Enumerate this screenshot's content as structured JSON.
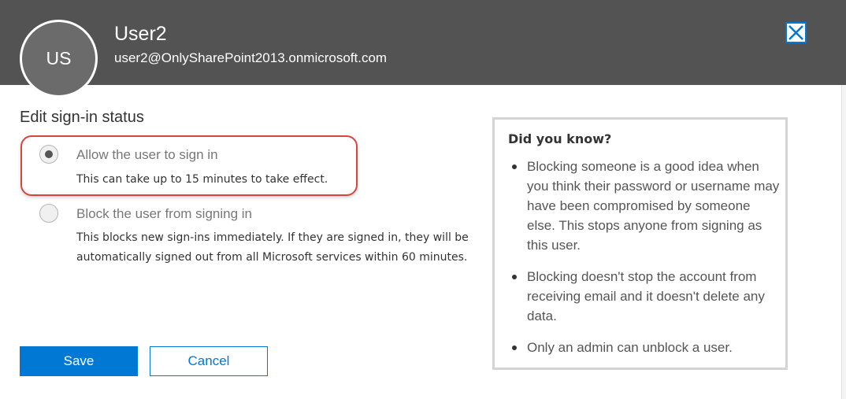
{
  "user": {
    "initials": "US",
    "name": "User2",
    "email": "user2@OnlySharePoint2013.onmicrosoft.com"
  },
  "section_title": "Edit sign-in status",
  "options": [
    {
      "label": "Allow the user to sign in",
      "description": "This can take up to 15 minutes to take effect.",
      "selected": true
    },
    {
      "label": "Block the user from signing in",
      "description": "This blocks new sign-ins immediately. If they are signed in, they will be automatically signed out from all Microsoft services within 60 minutes.",
      "selected": false
    }
  ],
  "buttons": {
    "save": "Save",
    "cancel": "Cancel"
  },
  "info": {
    "title": "Did you know?",
    "items": [
      "Blocking someone is a good idea when you think their password or username may have been compromised by someone else. This stops anyone from signing as this user.",
      "Blocking doesn't stop the account from receiving email and it doesn't delete any data.",
      "Only an admin can unblock a user."
    ]
  },
  "colors": {
    "header_bg": "#535353",
    "accent": "#0078d4",
    "highlight": "#d9443f"
  },
  "icons": {
    "close": "close-icon"
  }
}
